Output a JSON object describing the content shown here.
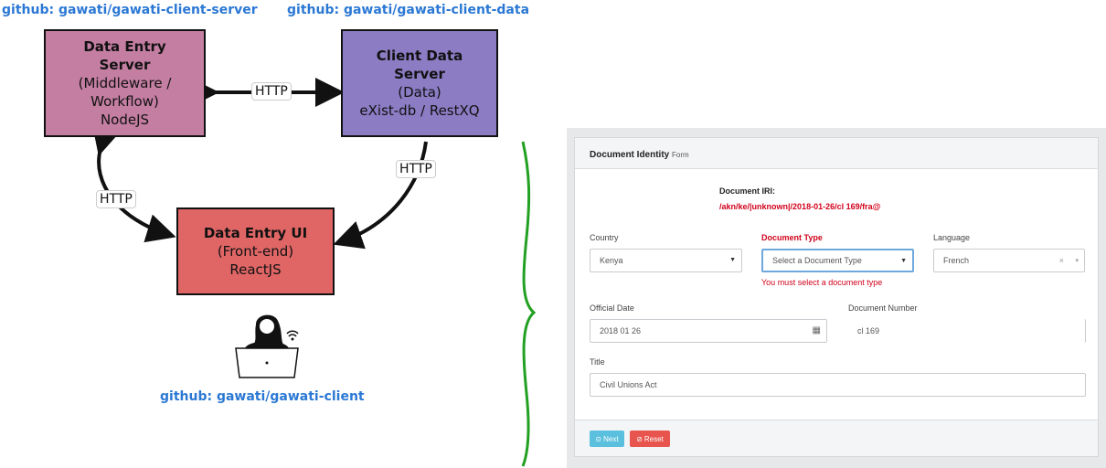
{
  "diagram": {
    "repo_server": "github: gawati/gawati-client-server",
    "repo_data": "github: gawati/gawati-client-data",
    "repo_client": "github: gawati/gawati-client",
    "nodes": {
      "server": {
        "title": "Data Entry\nServer",
        "lines": [
          "(Middleware /",
          "Workflow)",
          "NodeJS"
        ],
        "color": "#c47ea2"
      },
      "data": {
        "title": "Client Data\nServer",
        "lines": [
          "(Data)",
          "eXist-db / RestXQ"
        ],
        "color": "#8b7cc4"
      },
      "ui": {
        "title": "Data Entry UI",
        "lines": [
          "(Front-end)",
          "ReactJS"
        ],
        "color": "#e06666"
      }
    },
    "edge_labels": {
      "server_data": "HTTP",
      "data_ui": "HTTP",
      "server_ui": "HTTP"
    },
    "brace_color": "#22a022"
  },
  "form": {
    "panel_title": "Document Identity",
    "panel_subtitle": "Form",
    "iri_label": "Document IRI:",
    "iri_value": "/akn/ke/|unknown|/2018-01-26/cl 169/fra@",
    "country_label": "Country",
    "country_value": "Kenya",
    "doctype_label": "Document Type",
    "doctype_value": "Select a Document Type",
    "doctype_error": "You must select a document type",
    "language_label": "Language",
    "language_value": "French",
    "date_label": "Official Date",
    "date_value": "2018 01 26",
    "docnum_label": "Document Number",
    "docnum_value": "cl 169",
    "title_label": "Title",
    "title_value": "Civil Unions Act",
    "next_label": "Next",
    "reset_label": "Reset",
    "next_color": "#5bc0de",
    "reset_color": "#e8554e"
  }
}
